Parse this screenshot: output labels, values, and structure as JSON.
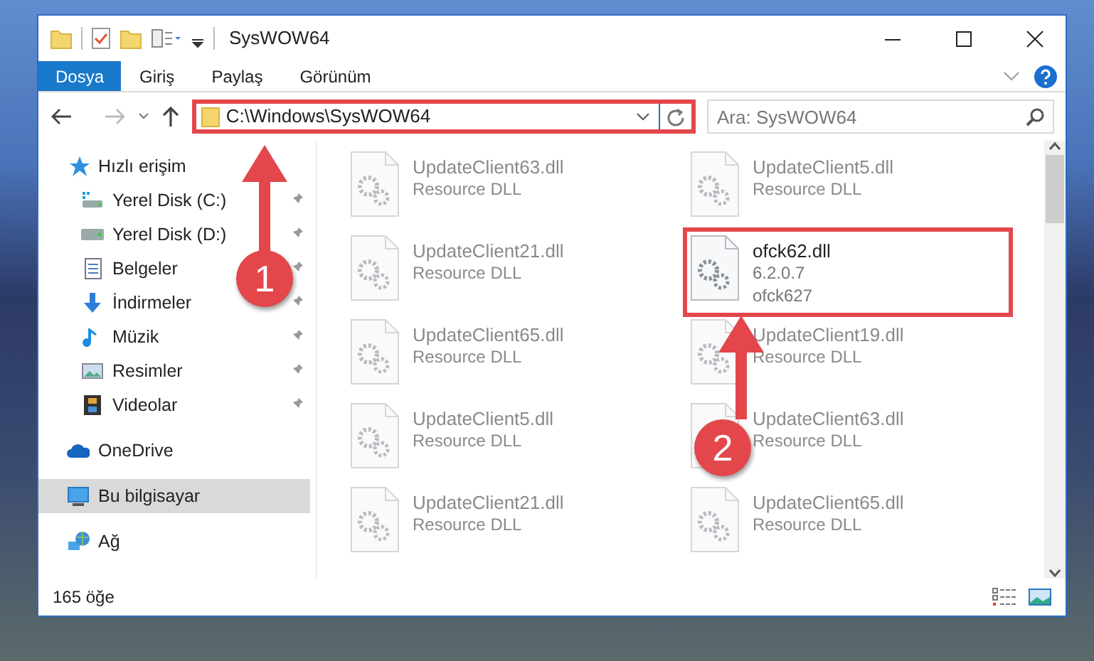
{
  "window": {
    "title": "SysWOW64"
  },
  "ribbon": {
    "tabs": [
      {
        "label": "Dosya",
        "selected": true
      },
      {
        "label": "Giriş",
        "selected": false
      },
      {
        "label": "Paylaş",
        "selected": false
      },
      {
        "label": "Görünüm",
        "selected": false
      }
    ]
  },
  "address_bar": {
    "path": "C:\\Windows\\SysWOW64",
    "highlighted": true
  },
  "search": {
    "placeholder": "Ara: SysWOW64"
  },
  "sidebar": {
    "items": [
      {
        "label": "Hızlı erişim",
        "kind": "quick",
        "selected": false,
        "children": [
          {
            "label": "Yerel Disk (C:)",
            "kind": "disk-c",
            "pinned": true
          },
          {
            "label": "Yerel Disk (D:)",
            "kind": "disk",
            "pinned": true
          },
          {
            "label": "Belgeler",
            "kind": "docs",
            "pinned": true
          },
          {
            "label": "İndirmeler",
            "kind": "down",
            "pinned": true
          },
          {
            "label": "Müzik",
            "kind": "music",
            "pinned": true
          },
          {
            "label": "Resimler",
            "kind": "pics",
            "pinned": true
          },
          {
            "label": "Videolar",
            "kind": "video",
            "pinned": true
          }
        ]
      },
      {
        "label": "OneDrive",
        "kind": "cloud",
        "selected": false
      },
      {
        "label": "Bu bilgisayar",
        "kind": "pc",
        "selected": true
      },
      {
        "label": "Ağ",
        "kind": "net",
        "selected": false
      }
    ]
  },
  "files": [
    {
      "name": "UpdateClient63.dll",
      "details": [
        "Resource DLL"
      ],
      "blurred": true,
      "highlighted": false
    },
    {
      "name": "UpdateClient5.dll",
      "details": [
        "Resource DLL"
      ],
      "blurred": true,
      "highlighted": false
    },
    {
      "name": "UpdateClient21.dll",
      "details": [
        "Resource DLL"
      ],
      "blurred": true,
      "highlighted": false
    },
    {
      "name": "ofck62.dll",
      "details": [
        "6.2.0.7",
        "ofck627"
      ],
      "blurred": false,
      "highlighted": true
    },
    {
      "name": "UpdateClient65.dll",
      "details": [
        "Resource DLL"
      ],
      "blurred": true,
      "highlighted": false
    },
    {
      "name": "UpdateClient19.dll",
      "details": [
        "Resource DLL"
      ],
      "blurred": true,
      "highlighted": false
    },
    {
      "name": "UpdateClient5.dll",
      "details": [
        "Resource DLL"
      ],
      "blurred": true,
      "highlighted": false
    },
    {
      "name": "UpdateClient63.dll",
      "details": [
        "Resource DLL"
      ],
      "blurred": true,
      "highlighted": false
    },
    {
      "name": "UpdateClient21.dll",
      "details": [
        "Resource DLL"
      ],
      "blurred": true,
      "highlighted": false
    },
    {
      "name": "UpdateClient65.dll",
      "details": [
        "Resource DLL"
      ],
      "blurred": true,
      "highlighted": false
    }
  ],
  "status_bar": {
    "count": "165 öğe"
  },
  "annotations": [
    {
      "label": "1"
    },
    {
      "label": "2"
    }
  ]
}
